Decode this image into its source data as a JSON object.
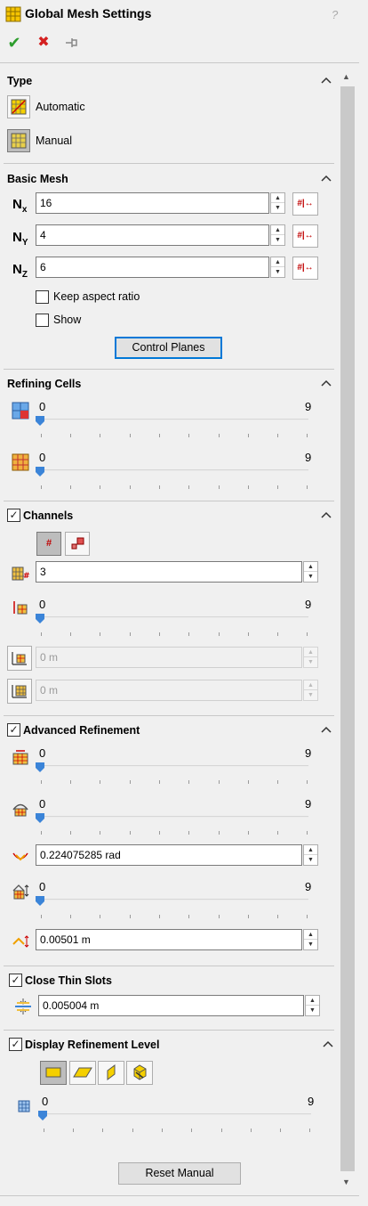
{
  "header": {
    "title": "Global Mesh Settings",
    "help": "?"
  },
  "toolbar": {
    "ok": "✔",
    "cancel": "✖",
    "pin": "⊣"
  },
  "type": {
    "title": "Type",
    "automatic": "Automatic",
    "manual": "Manual"
  },
  "basic_mesh": {
    "title": "Basic Mesh",
    "nx_label": "N",
    "nx_sub": "x",
    "nx_value": "16",
    "ny_label": "N",
    "ny_sub": "Y",
    "ny_value": "4",
    "nz_label": "N",
    "nz_sub": "Z",
    "nz_value": "6",
    "keep_aspect_ratio": "Keep aspect ratio",
    "show": "Show",
    "control_planes": "Control Planes"
  },
  "refining_cells": {
    "title": "Refining Cells",
    "slider1": {
      "value": "0",
      "max": "9"
    },
    "slider2": {
      "value": "0",
      "max": "9"
    }
  },
  "channels": {
    "title": "Channels",
    "checked": true,
    "count_value": "3",
    "slider": {
      "value": "0",
      "max": "9"
    },
    "field1_value": "0 m",
    "field2_value": "0 m"
  },
  "advanced_refinement": {
    "title": "Advanced Refinement",
    "checked": true,
    "slider1": {
      "value": "0",
      "max": "9"
    },
    "slider2": {
      "value": "0",
      "max": "9"
    },
    "angle_value": "0.224075285 rad",
    "slider3": {
      "value": "0",
      "max": "9"
    },
    "length_value": "0.00501 m"
  },
  "close_thin_slots": {
    "title": "Close Thin Slots",
    "checked": true,
    "value": "0.005004 m"
  },
  "display_refinement_level": {
    "title": "Display Refinement Level",
    "checked": true,
    "slider": {
      "value": "0",
      "max": "9"
    },
    "reset_manual": "Reset Manual"
  },
  "colors": {
    "check_green": "#2e9e2e",
    "cancel_red": "#d42020",
    "focus_blue": "#0078d7",
    "icon_red": "#c00000"
  }
}
